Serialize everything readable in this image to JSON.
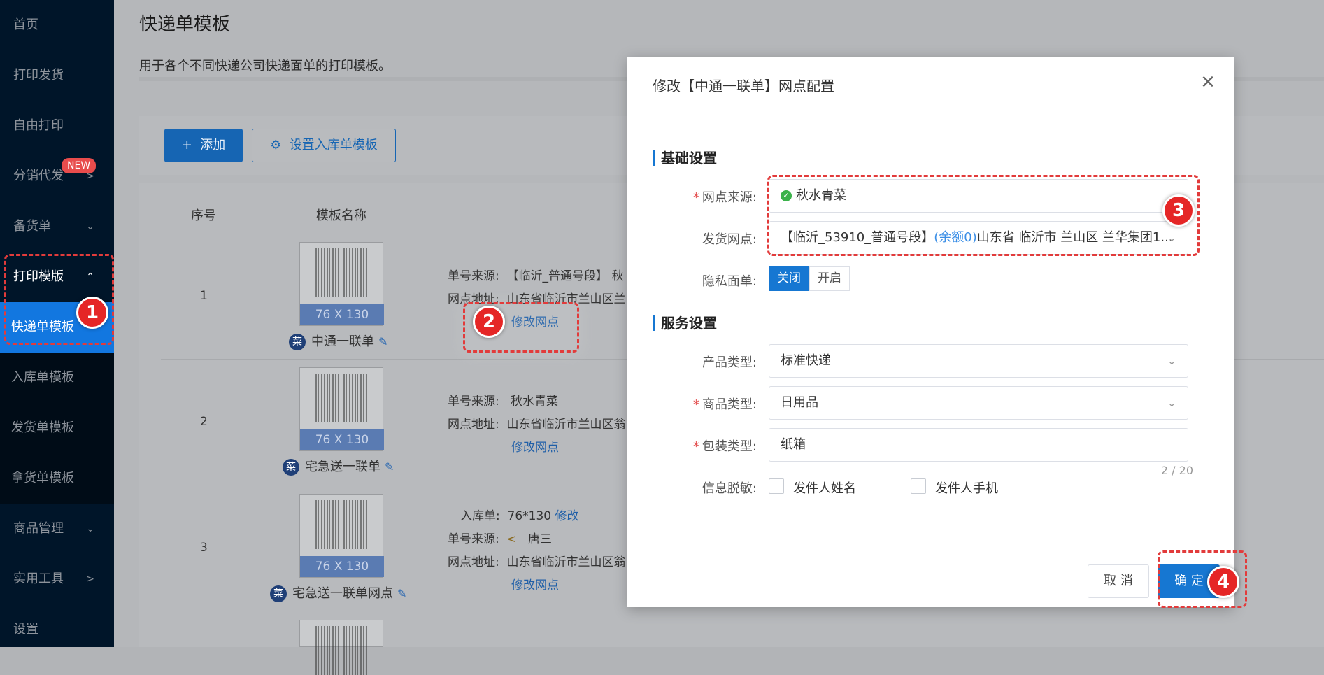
{
  "sidebar": {
    "items": [
      {
        "label": "首页"
      },
      {
        "label": "打印发货"
      },
      {
        "label": "自由打印"
      },
      {
        "label": "分销代发",
        "badge": "NEW"
      },
      {
        "label": "备货单"
      },
      {
        "label": "打印模版"
      },
      {
        "label": "快递单模板"
      },
      {
        "label": "入库单模板"
      },
      {
        "label": "发货单模板"
      },
      {
        "label": "拿货单模板"
      },
      {
        "label": "商品管理"
      },
      {
        "label": "实用工具"
      },
      {
        "label": "设置"
      }
    ]
  },
  "page": {
    "title": "快递单模板",
    "desc": "用于各个不同快递公司快递面单的打印模板。",
    "add_label": "添加",
    "set_inbound_label": "设置入库单模板",
    "columns": [
      "序号",
      "模板名称"
    ]
  },
  "rows": [
    {
      "num": "1",
      "size": "76 X 130",
      "name": "中通一联单",
      "line1_label": "单号来源:",
      "line1_value": "【临沂_普通号段】 秋",
      "line2_label": "网点地址:",
      "line2_value": "山东省临沂市兰山区兰",
      "link": "修改网点"
    },
    {
      "num": "2",
      "size": "76 X 130",
      "name": "宅急送一联单",
      "line1_label": "单号来源:",
      "line1_value": "秋水青菜",
      "line2_label": "网点地址:",
      "line2_value": "山东省临沂市兰山区翁",
      "link": "修改网点"
    },
    {
      "num": "3",
      "size": "76 X 130",
      "name": "宅急送一联单网点",
      "line0_label": "入库单:",
      "line0_value": "76*130",
      "line0_link": "修改",
      "line1_label": "单号来源:",
      "line1_value": "唐三",
      "line2_label": "网点地址:",
      "line2_value": "山东省临沂市兰山区翁",
      "link": "修改网点"
    }
  ],
  "dialog": {
    "title": "修改【中通一联单】网点配置",
    "section_basic": "基础设置",
    "source_label": "网点来源:",
    "source_value": "秋水青菜",
    "ship_label": "发货网点:",
    "ship_value_a": "【临沂_53910_普通号段】",
    "ship_value_b": "(余额0)",
    "ship_value_c": "山东省 临沂市 兰山区 兰华集团1...",
    "privacy_label": "隐私面单:",
    "privacy_off": "关闭",
    "privacy_on": "开启",
    "section_service": "服务设置",
    "product_label": "产品类型:",
    "product_value": "标准快递",
    "goods_label": "商品类型:",
    "goods_value": "日用品",
    "pack_label": "包装类型:",
    "pack_value": "纸箱",
    "pack_counter": "2 / 20",
    "mask_label": "信息脱敏:",
    "mask_opt1": "发件人姓名",
    "mask_opt2": "发件人手机",
    "cancel": "取 消",
    "ok": "确 定"
  },
  "markers": [
    "1",
    "2",
    "3",
    "4"
  ],
  "colors": {
    "sidebar_bg": "#001529",
    "accent": "#1677d2",
    "annotation": "#e23b3b"
  }
}
